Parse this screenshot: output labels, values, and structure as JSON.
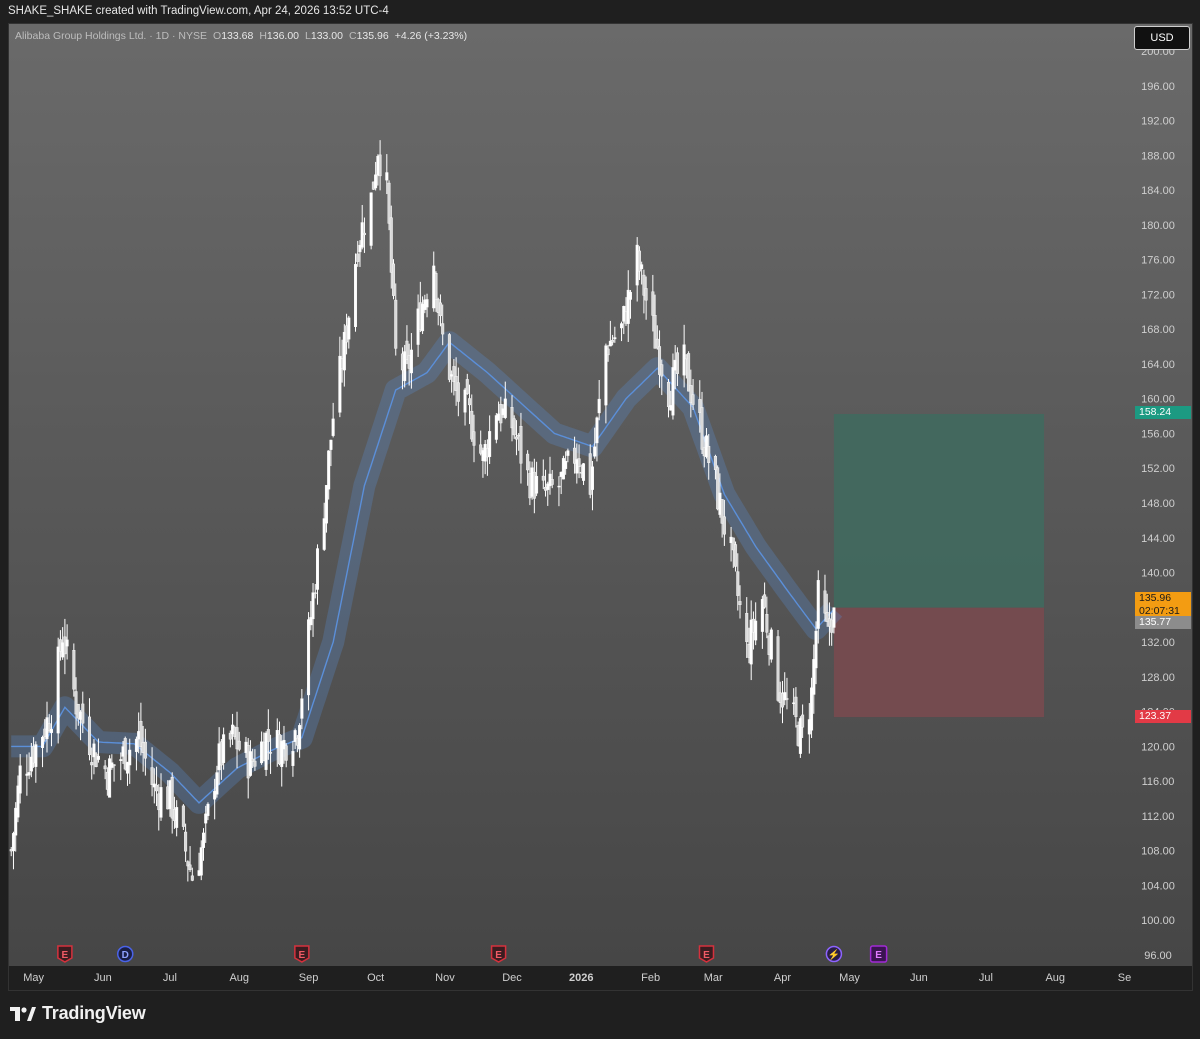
{
  "caption": "SHAKE_SHAKE created with TradingView.com, Apr 24, 2026 13:52 UTC-4",
  "legend": {
    "symbol": "Alibaba Group Holdings Ltd. · 1D · NYSE",
    "o_label": "O",
    "o_value": "133.68",
    "h_label": "H",
    "h_value": "136.00",
    "l_label": "L",
    "l_value": "133.00",
    "c_label": "C",
    "c_value": "135.96",
    "change": "+4.26 (+3.23%)"
  },
  "currency_button": "USD",
  "brand": "TradingView",
  "colors": {
    "background_top": "#6a6a6a",
    "background_bottom": "#464646",
    "candle": "#ffffff",
    "ma_line": "#5b8fd9",
    "target_zone": "#3f6b5f",
    "stop_zone": "#7a4a4f",
    "target_tag": "#1c9a82",
    "stop_tag": "#e23a46",
    "last_price_tag": "#f39c12",
    "ma_tag": "#8c8c8c"
  },
  "price_tags": {
    "target": "158.24",
    "last_price": "135.96",
    "countdown": "02:07:31",
    "ma_value": "135.77",
    "stop": "123.37"
  },
  "event_markers": [
    {
      "date": "2025-05-15",
      "kind": "earnings",
      "label": "E"
    },
    {
      "date": "2025-06-11",
      "kind": "dividend",
      "label": "D"
    },
    {
      "date": "2025-08-29",
      "kind": "earnings",
      "label": "E"
    },
    {
      "date": "2025-11-25",
      "kind": "earnings",
      "label": "E"
    },
    {
      "date": "2026-02-26",
      "kind": "earnings",
      "label": "E"
    },
    {
      "date": "2026-04-24",
      "kind": "flash",
      "label": "⚡"
    },
    {
      "date": "2026-05-14",
      "kind": "earnings-upcoming",
      "label": "E"
    }
  ],
  "chart_data": {
    "type": "candlestick",
    "y_axis_ticks": [
      "96.00",
      "100.00",
      "104.00",
      "108.00",
      "112.00",
      "116.00",
      "120.00",
      "124.00",
      "128.00",
      "132.00",
      "136.00",
      "140.00",
      "144.00",
      "148.00",
      "152.00",
      "156.00",
      "160.00",
      "164.00",
      "168.00",
      "172.00",
      "176.00",
      "180.00",
      "184.00",
      "188.00",
      "192.00",
      "196.00",
      "200.00"
    ],
    "ylim": [
      95,
      201
    ],
    "x_axis_ticks": [
      {
        "label": "May",
        "date": "2025-05-01"
      },
      {
        "label": "Jun",
        "date": "2025-06-01"
      },
      {
        "label": "Jul",
        "date": "2025-07-01"
      },
      {
        "label": "Aug",
        "date": "2025-08-01"
      },
      {
        "label": "Sep",
        "date": "2025-09-01"
      },
      {
        "label": "Oct",
        "date": "2025-10-01"
      },
      {
        "label": "Nov",
        "date": "2025-11-01"
      },
      {
        "label": "Dec",
        "date": "2025-12-01"
      },
      {
        "label": "2026",
        "date": "2026-01-01",
        "bold": true
      },
      {
        "label": "Feb",
        "date": "2026-02-01"
      },
      {
        "label": "Mar",
        "date": "2026-03-01"
      },
      {
        "label": "Apr",
        "date": "2026-04-01"
      },
      {
        "label": "May",
        "date": "2026-05-01"
      },
      {
        "label": "Jun",
        "date": "2026-06-01"
      },
      {
        "label": "Jul",
        "date": "2026-07-01"
      },
      {
        "label": "Aug",
        "date": "2026-08-01"
      },
      {
        "label": "Se",
        "date": "2026-09-01"
      }
    ],
    "xlim": [
      "2025-04-20",
      "2026-09-03"
    ],
    "price_path": [
      {
        "date": "2025-04-21",
        "close": 108
      },
      {
        "date": "2025-04-25",
        "close": 117
      },
      {
        "date": "2025-05-02",
        "close": 120
      },
      {
        "date": "2025-05-09",
        "close": 124
      },
      {
        "date": "2025-05-14",
        "close": 133
      },
      {
        "date": "2025-05-20",
        "close": 125
      },
      {
        "date": "2025-05-27",
        "close": 120
      },
      {
        "date": "2025-06-03",
        "close": 117
      },
      {
        "date": "2025-06-10",
        "close": 119
      },
      {
        "date": "2025-06-17",
        "close": 121
      },
      {
        "date": "2025-06-24",
        "close": 115
      },
      {
        "date": "2025-07-01",
        "close": 114
      },
      {
        "date": "2025-07-07",
        "close": 109
      },
      {
        "date": "2025-07-11",
        "close": 105
      },
      {
        "date": "2025-07-16",
        "close": 109
      },
      {
        "date": "2025-07-22",
        "close": 118
      },
      {
        "date": "2025-07-29",
        "close": 121
      },
      {
        "date": "2025-08-06",
        "close": 118
      },
      {
        "date": "2025-08-13",
        "close": 121
      },
      {
        "date": "2025-08-20",
        "close": 120
      },
      {
        "date": "2025-08-27",
        "close": 122
      },
      {
        "date": "2025-09-02",
        "close": 135
      },
      {
        "date": "2025-09-08",
        "close": 148
      },
      {
        "date": "2025-09-12",
        "close": 158
      },
      {
        "date": "2025-09-17",
        "close": 166
      },
      {
        "date": "2025-09-23",
        "close": 178
      },
      {
        "date": "2025-09-29",
        "close": 183
      },
      {
        "date": "2025-10-02",
        "close": 189
      },
      {
        "date": "2025-10-06",
        "close": 184
      },
      {
        "date": "2025-10-10",
        "close": 165
      },
      {
        "date": "2025-10-15",
        "close": 163
      },
      {
        "date": "2025-10-21",
        "close": 170
      },
      {
        "date": "2025-10-27",
        "close": 176
      },
      {
        "date": "2025-10-30",
        "close": 168
      },
      {
        "date": "2025-11-05",
        "close": 161
      },
      {
        "date": "2025-11-12",
        "close": 158
      },
      {
        "date": "2025-11-18",
        "close": 153
      },
      {
        "date": "2025-11-24",
        "close": 159
      },
      {
        "date": "2025-12-01",
        "close": 157
      },
      {
        "date": "2025-12-08",
        "close": 151
      },
      {
        "date": "2025-12-15",
        "close": 149
      },
      {
        "date": "2025-12-22",
        "close": 150
      },
      {
        "date": "2025-12-30",
        "close": 154
      },
      {
        "date": "2026-01-05",
        "close": 150
      },
      {
        "date": "2026-01-12",
        "close": 166
      },
      {
        "date": "2026-01-19",
        "close": 168
      },
      {
        "date": "2026-01-26",
        "close": 176
      },
      {
        "date": "2026-02-02",
        "close": 168
      },
      {
        "date": "2026-02-09",
        "close": 161
      },
      {
        "date": "2026-02-16",
        "close": 164
      },
      {
        "date": "2026-02-23",
        "close": 157
      },
      {
        "date": "2026-03-02",
        "close": 150
      },
      {
        "date": "2026-03-09",
        "close": 142
      },
      {
        "date": "2026-03-16",
        "close": 131
      },
      {
        "date": "2026-03-23",
        "close": 137
      },
      {
        "date": "2026-03-30",
        "close": 127
      },
      {
        "date": "2026-04-06",
        "close": 123
      },
      {
        "date": "2026-04-10",
        "close": 121
      },
      {
        "date": "2026-04-14",
        "close": 126
      },
      {
        "date": "2026-04-17",
        "close": 137
      },
      {
        "date": "2026-04-21",
        "close": 133
      },
      {
        "date": "2026-04-24",
        "close": 135.96
      }
    ],
    "ma_path": [
      {
        "date": "2025-04-21",
        "value": 120
      },
      {
        "date": "2025-05-05",
        "value": 120
      },
      {
        "date": "2025-05-15",
        "value": 124.5
      },
      {
        "date": "2025-05-30",
        "value": 120.5
      },
      {
        "date": "2025-06-15",
        "value": 120.3
      },
      {
        "date": "2025-07-01",
        "value": 117
      },
      {
        "date": "2025-07-14",
        "value": 113.5
      },
      {
        "date": "2025-07-31",
        "value": 117.5
      },
      {
        "date": "2025-08-15",
        "value": 119.5
      },
      {
        "date": "2025-08-29",
        "value": 121
      },
      {
        "date": "2025-09-12",
        "value": 132
      },
      {
        "date": "2025-09-26",
        "value": 150
      },
      {
        "date": "2025-10-10",
        "value": 161
      },
      {
        "date": "2025-10-24",
        "value": 163
      },
      {
        "date": "2025-11-03",
        "value": 166.5
      },
      {
        "date": "2025-11-20",
        "value": 163
      },
      {
        "date": "2025-12-05",
        "value": 159.5
      },
      {
        "date": "2025-12-20",
        "value": 156
      },
      {
        "date": "2026-01-06",
        "value": 154.5
      },
      {
        "date": "2026-01-21",
        "value": 160
      },
      {
        "date": "2026-02-04",
        "value": 163.5
      },
      {
        "date": "2026-02-20",
        "value": 159
      },
      {
        "date": "2026-03-06",
        "value": 149
      },
      {
        "date": "2026-03-20",
        "value": 143
      },
      {
        "date": "2026-04-03",
        "value": 138
      },
      {
        "date": "2026-04-16",
        "value": 133.5
      },
      {
        "date": "2026-04-24",
        "value": 135.77
      }
    ],
    "position": {
      "start": "2026-04-24",
      "end": "2026-07-27",
      "entry": 135.96,
      "target": 158.24,
      "stop": 123.37
    }
  }
}
